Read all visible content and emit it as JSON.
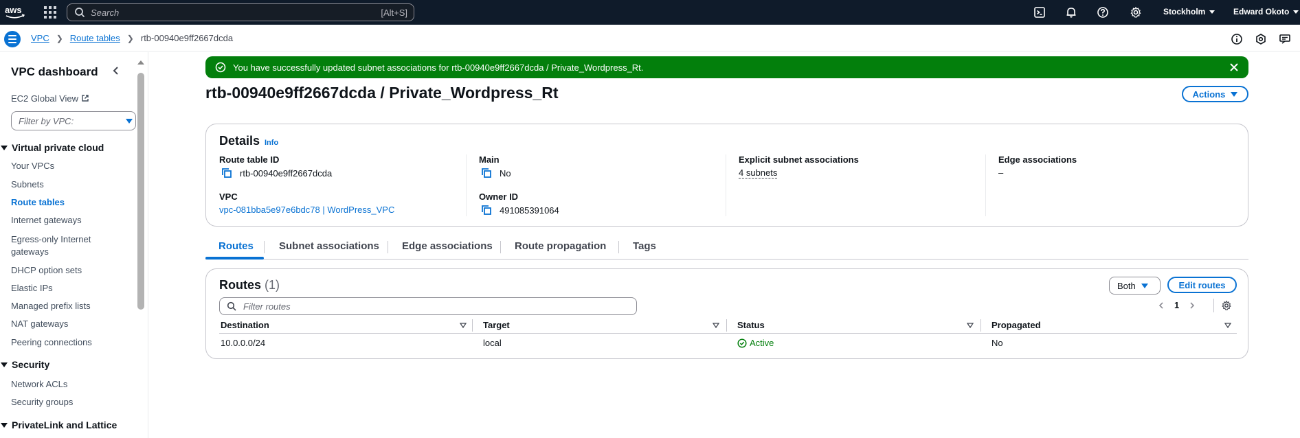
{
  "topnav": {
    "logo_text": "aws",
    "search_placeholder": "Search",
    "search_shortcut": "[Alt+S]",
    "region": "Stockholm",
    "user": "Edward Okoto"
  },
  "breadcrumb": {
    "items": [
      "VPC",
      "Route tables"
    ],
    "current": "rtb-00940e9ff2667dcda"
  },
  "sidebar": {
    "title": "VPC dashboard",
    "ec2_global_view": "EC2 Global View",
    "filter_placeholder": "Filter by VPC:",
    "sections": {
      "vpc": {
        "label": "Virtual private cloud",
        "items": [
          "Your VPCs",
          "Subnets",
          "Route tables",
          "Internet gateways",
          "Egress-only Internet gateways",
          "DHCP option sets",
          "Elastic IPs",
          "Managed prefix lists",
          "NAT gateways",
          "Peering connections"
        ],
        "active": "Route tables"
      },
      "security": {
        "label": "Security",
        "items": [
          "Network ACLs",
          "Security groups"
        ]
      },
      "privatelink": {
        "label": "PrivateLink and Lattice"
      }
    }
  },
  "flash": {
    "message": "You have successfully updated subnet associations for rtb-00940e9ff2667dcda / Private_Wordpress_Rt.",
    "color": "#037f0c"
  },
  "page": {
    "title": "rtb-00940e9ff2667dcda / Private_Wordpress_Rt",
    "actions_label": "Actions"
  },
  "details": {
    "title": "Details",
    "info": "Info",
    "route_table_id_label": "Route table ID",
    "route_table_id": "rtb-00940e9ff2667dcda",
    "main_label": "Main",
    "main": "No",
    "explicit_label": "Explicit subnet associations",
    "explicit": "4 subnets",
    "edge_label": "Edge associations",
    "edge": "–",
    "vpc_label": "VPC",
    "vpc": "vpc-081bba5e97e6bdc78 | WordPress_VPC",
    "owner_label": "Owner ID",
    "owner": "491085391064"
  },
  "tabs": [
    "Routes",
    "Subnet associations",
    "Edge associations",
    "Route propagation",
    "Tags"
  ],
  "routes": {
    "title": "Routes",
    "count": "(1)",
    "both_label": "Both",
    "edit_label": "Edit routes",
    "filter_placeholder": "Filter routes",
    "page": "1",
    "columns": [
      "Destination",
      "Target",
      "Status",
      "Propagated"
    ],
    "rows": [
      {
        "destination": "10.0.0.0/24",
        "target": "local",
        "status": "Active",
        "propagated": "No"
      }
    ]
  },
  "colors": {
    "accent": "#0972d3",
    "nav_bg": "#0f1b2a",
    "success": "#037f0c"
  }
}
